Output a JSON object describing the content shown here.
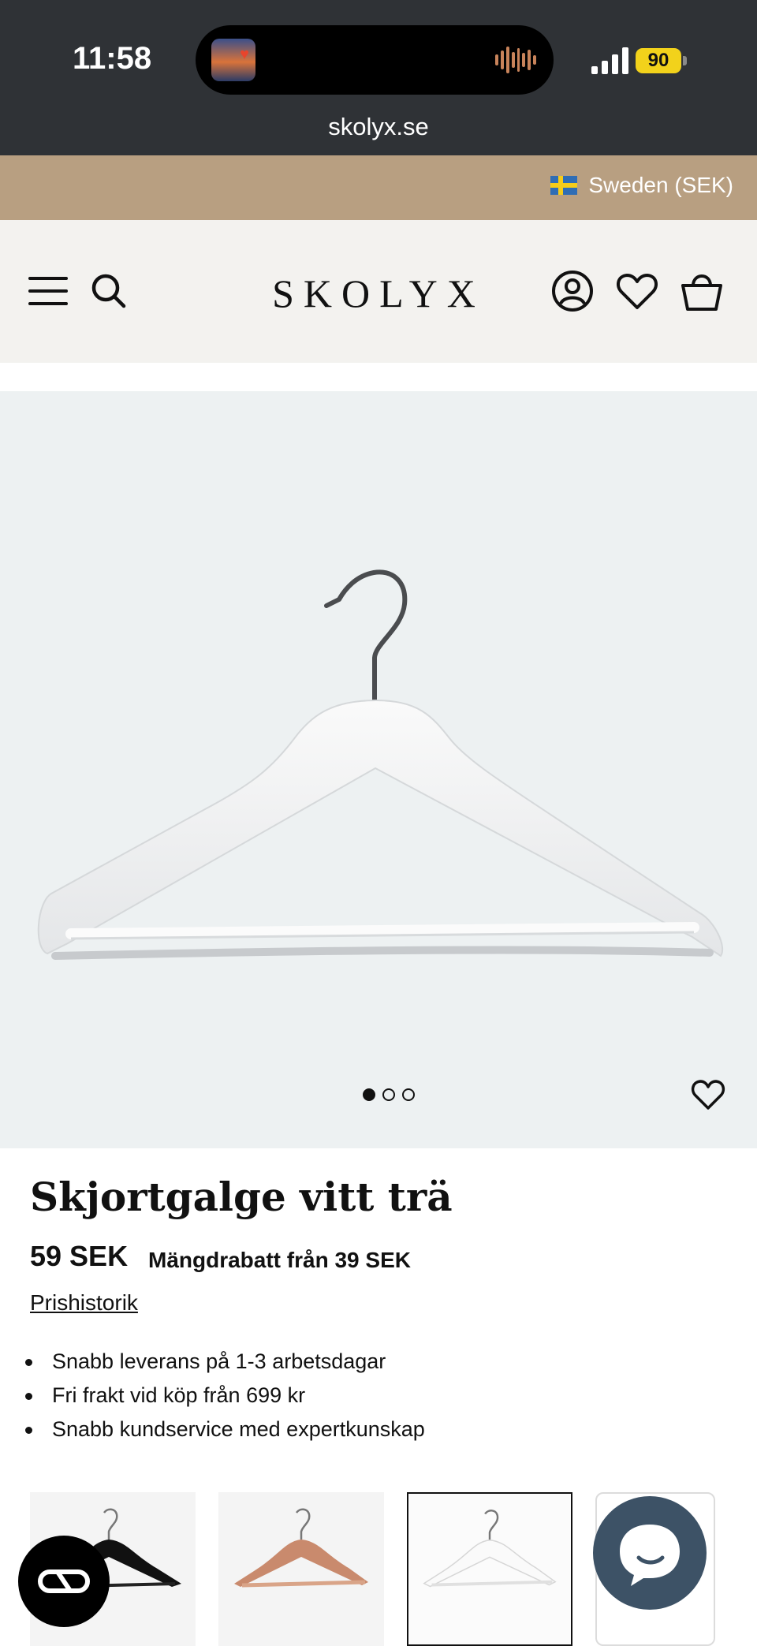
{
  "status_bar": {
    "time": "11:58",
    "battery": "90",
    "url": "skolyx.se"
  },
  "country_selector": {
    "label": "Sweden (SEK)",
    "flag": "sweden-flag"
  },
  "header": {
    "logo": "SKOLYX",
    "icons": [
      "menu-icon",
      "search-icon",
      "account-icon",
      "heart-icon",
      "bag-icon"
    ]
  },
  "gallery": {
    "image_count": 3,
    "active_index": 0
  },
  "product": {
    "title": "Skjortgalge vitt trä",
    "price": "59 SEK",
    "bulk_label": "Mängdrabatt från",
    "bulk_price": "39 SEK",
    "price_history_link": "Prishistorik",
    "usps": [
      "Snabb leverans på 1-3 arbetsdagar",
      "Fri frakt vid köp från 699 kr",
      "Snabb kundservice med expertkunskap"
    ]
  },
  "variants": [
    {
      "name": "black",
      "color": "#111111",
      "selected": false
    },
    {
      "name": "cedar",
      "color": "#c98a6d",
      "selected": false
    },
    {
      "name": "white",
      "color": "#ffffff",
      "selected": true
    },
    {
      "name": "partial",
      "color": "#ffffff",
      "selected": false
    }
  ],
  "colors": {
    "status_bar": "#2f3236",
    "country_bar": "#b89f81",
    "header_bg": "#f3f2ef",
    "hero_bg": "#edf1f2",
    "chat_button": "#3d5266",
    "battery": "#f2d21b"
  }
}
